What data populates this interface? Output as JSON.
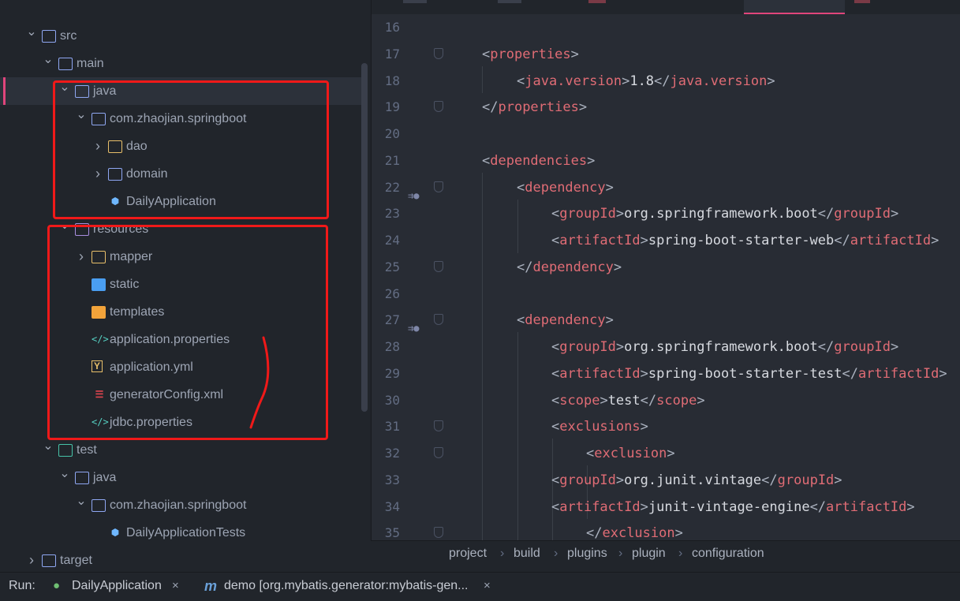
{
  "tree": {
    "items": [
      {
        "label": "src",
        "icon": "source-folder-icon",
        "arrow": "expanded"
      },
      {
        "label": "main",
        "icon": "folder-icon",
        "arrow": "expanded"
      },
      {
        "label": "java",
        "icon": "folder-icon",
        "arrow": "expanded",
        "selected": true
      },
      {
        "label": "com.zhaojian.springboot",
        "icon": "package-icon",
        "arrow": "expanded"
      },
      {
        "label": "dao",
        "icon": "folder-icon",
        "arrow": "collapsed"
      },
      {
        "label": "domain",
        "icon": "folder-icon",
        "arrow": "collapsed"
      },
      {
        "label": "DailyApplication",
        "icon": "spring-class-icon"
      },
      {
        "label": "resources",
        "icon": "resources-folder-icon",
        "arrow": "expanded"
      },
      {
        "label": "mapper",
        "icon": "folder-icon",
        "arrow": "collapsed"
      },
      {
        "label": "static",
        "icon": "web-folder-icon"
      },
      {
        "label": "templates",
        "icon": "templates-folder-icon"
      },
      {
        "label": "application.properties",
        "icon": "properties-file-icon"
      },
      {
        "label": "application.yml",
        "icon": "yml-file-icon"
      },
      {
        "label": "generatorConfig.xml",
        "icon": "xml-file-icon"
      },
      {
        "label": "jdbc.properties",
        "icon": "properties-file-icon"
      },
      {
        "label": "test",
        "icon": "test-folder-icon",
        "arrow": "expanded"
      },
      {
        "label": "java",
        "icon": "folder-icon",
        "arrow": "expanded"
      },
      {
        "label": "com.zhaojian.springboot",
        "icon": "package-icon",
        "arrow": "expanded"
      },
      {
        "label": "DailyApplicationTests",
        "icon": "spring-class-icon"
      },
      {
        "label": "target",
        "icon": "folder-icon",
        "arrow": "collapsed"
      }
    ]
  },
  "editor": {
    "lines": [
      {
        "n": "16",
        "tag": "",
        "text": ""
      },
      {
        "n": "17",
        "tag": "properties",
        "text": ""
      },
      {
        "n": "18",
        "tag": "java.version",
        "text": "1.8"
      },
      {
        "n": "19",
        "tag": "/properties",
        "text": ""
      },
      {
        "n": "20",
        "tag": "",
        "text": ""
      },
      {
        "n": "21",
        "tag": "dependencies",
        "text": ""
      },
      {
        "n": "22",
        "tag": "dependency",
        "text": ""
      },
      {
        "n": "23",
        "tag": "groupId",
        "text": "org.springframework.boot"
      },
      {
        "n": "24",
        "tag": "artifactId",
        "text": "spring-boot-starter-web",
        "close": "artifactId>"
      },
      {
        "n": "25",
        "tag": "/dependency",
        "text": ""
      },
      {
        "n": "26",
        "tag": "",
        "text": ""
      },
      {
        "n": "27",
        "tag": "dependency",
        "text": ""
      },
      {
        "n": "28",
        "tag": "groupId",
        "text": "org.springframework.boot"
      },
      {
        "n": "29",
        "tag": "artifactId",
        "text": "spring-boot-starter-test",
        "close": "artifactId>"
      },
      {
        "n": "30",
        "tag": "scope",
        "text": "test"
      },
      {
        "n": "31",
        "tag": "exclusions",
        "text": ""
      },
      {
        "n": "32",
        "tag": "exclusion",
        "text": ""
      },
      {
        "n": "33",
        "tag": "groupId",
        "text": "org.junit.vintage"
      },
      {
        "n": "34",
        "tag": "artifactId",
        "text": "junit-vintage-engine",
        "close": "artifactId>"
      },
      {
        "n": "35",
        "tag": "/exclusion",
        "text": ""
      }
    ]
  },
  "breadcrumb": [
    "project",
    "build",
    "plugins",
    "plugin",
    "configuration"
  ],
  "runbar": {
    "label": "Run:",
    "tab1": "DailyApplication",
    "tab2": "demo [org.mybatis.generator:mybatis-gen...",
    "close": "×",
    "m_glyph": "m"
  },
  "colors": {
    "accent": "#e0457b",
    "annotation": "#f01919",
    "tag": "#e06c75"
  }
}
